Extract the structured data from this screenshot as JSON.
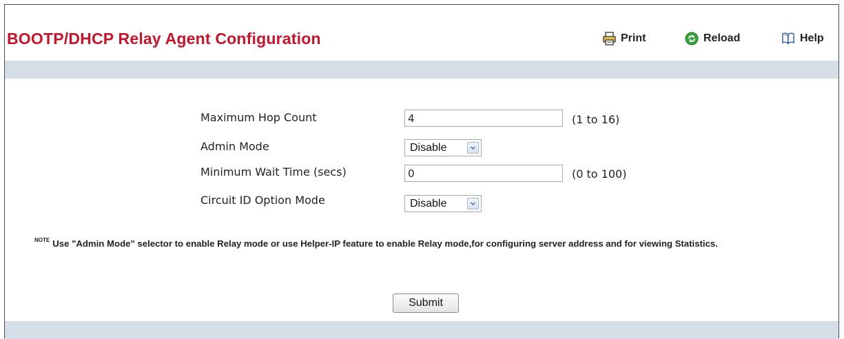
{
  "page": {
    "title": "BOOTP/DHCP Relay Agent Configuration"
  },
  "toolbar": {
    "print_label": "Print",
    "reload_label": "Reload",
    "help_label": "Help",
    "print_icon": "printer-icon",
    "reload_icon": "reload-icon",
    "help_icon": "help-book-icon"
  },
  "form": {
    "max_hop_count": {
      "label": "Maximum Hop Count",
      "value": "4",
      "range": "(1 to 16)"
    },
    "admin_mode": {
      "label": "Admin Mode",
      "value": "Disable"
    },
    "min_wait_time": {
      "label": "Minimum Wait Time (secs)",
      "value": "0",
      "range": "(0 to 100)"
    },
    "circuit_id_option_mode": {
      "label": "Circuit ID Option Mode",
      "value": "Disable"
    }
  },
  "note": {
    "tag": "NOTE",
    "text": "Use \"Admin Mode\" selector to enable Relay mode or use Helper-IP feature to enable Relay mode,for configuring server address and for viewing Statistics."
  },
  "actions": {
    "submit_label": "Submit"
  },
  "colors": {
    "title_red": "#c8142a",
    "band": "#d5dde7",
    "reload_green": "#3aa23a"
  }
}
